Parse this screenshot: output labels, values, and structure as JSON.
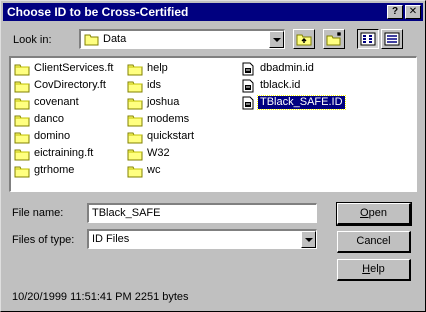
{
  "window": {
    "title": "Choose ID to be Cross-Certified",
    "help_glyph": "?",
    "close_glyph": "✕"
  },
  "look_in": {
    "label": "Look in:",
    "value": "Data",
    "icon": "folder-icon"
  },
  "toolbar": [
    {
      "name": "up-one-level-button",
      "icon": "up-folder-icon"
    },
    {
      "name": "create-new-folder-button",
      "icon": "new-folder-icon"
    },
    {
      "name": "list-view-button",
      "icon": "list-view-icon",
      "pressed": true
    },
    {
      "name": "details-view-button",
      "icon": "details-view-icon",
      "pressed": false
    }
  ],
  "files": {
    "column1": [
      {
        "label": "ClientServices.ft",
        "type": "folder"
      },
      {
        "label": "CovDirectory.ft",
        "type": "folder"
      },
      {
        "label": "covenant",
        "type": "folder"
      },
      {
        "label": "danco",
        "type": "folder"
      },
      {
        "label": "domino",
        "type": "folder"
      },
      {
        "label": "eictraining.ft",
        "type": "folder"
      },
      {
        "label": "gtrhome",
        "type": "folder"
      }
    ],
    "column2": [
      {
        "label": "help",
        "type": "folder"
      },
      {
        "label": "ids",
        "type": "folder"
      },
      {
        "label": "joshua",
        "type": "folder"
      },
      {
        "label": "modems",
        "type": "folder"
      },
      {
        "label": "quickstart",
        "type": "folder"
      },
      {
        "label": "W32",
        "type": "folder"
      },
      {
        "label": "wc",
        "type": "folder"
      }
    ],
    "column3": [
      {
        "label": "dbadmin.id",
        "type": "id-file"
      },
      {
        "label": "tblack.id",
        "type": "id-file"
      },
      {
        "label": "TBlack_SAFE.ID",
        "type": "id-file",
        "selected": true
      }
    ]
  },
  "file_name": {
    "label": "File name:",
    "value": "TBlack_SAFE"
  },
  "file_type": {
    "label": "Files of type:",
    "value": "ID Files"
  },
  "buttons": {
    "open": "Open",
    "cancel": "Cancel",
    "help": "Help"
  },
  "status": "10/20/1999 11:51:41 PM 2251 bytes",
  "colors": {
    "title_bar": "#000080",
    "dialog_face": "#c0c0c0",
    "selection": "#000080",
    "folder": "#ffff80"
  }
}
